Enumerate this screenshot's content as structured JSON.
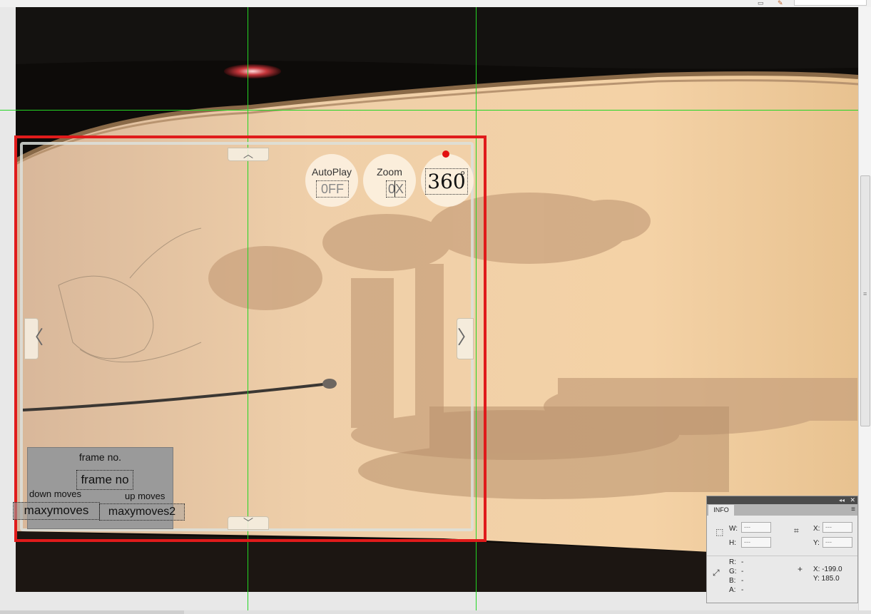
{
  "app": {
    "toolbar_icons": [
      "layout-icon",
      "brush-icon"
    ]
  },
  "viewer": {
    "nav": {
      "up": "︿",
      "down": "﹀",
      "left": "〈",
      "right": "〉"
    },
    "autoplay": {
      "label": "AutoPlay",
      "value": "0FF"
    },
    "zoom": {
      "label": "Zoom",
      "value": "0X"
    },
    "spin": {
      "value": "360",
      "degree": "o"
    },
    "frame_panel": {
      "title": "frame no.",
      "frame_field": "frame no",
      "down_label": "down moves",
      "up_label": "up moves",
      "max_left": "maxymoves",
      "max_right": "maxymoves2"
    }
  },
  "info_panel": {
    "title_controls": {
      "collapse": "◂◂",
      "close": "✕"
    },
    "tab": "INFO",
    "menu": "≡",
    "w_label": "W:",
    "w_value": "---",
    "h_label": "H:",
    "h_value": "---",
    "x_label": "X:",
    "x_value": "---",
    "y_label": "Y:",
    "y_value": "---",
    "r_label": "R:",
    "r_value": "-",
    "g_label": "G:",
    "g_value": "-",
    "b_label": "B:",
    "b_value": "-",
    "a_label": "A:",
    "a_value": "-",
    "cursor_x": "X:  -199.0",
    "cursor_y": "Y:  185.0"
  },
  "colors": {
    "selection": "#e01b1b",
    "guides": "#24d524",
    "indicator": "#e21010"
  }
}
